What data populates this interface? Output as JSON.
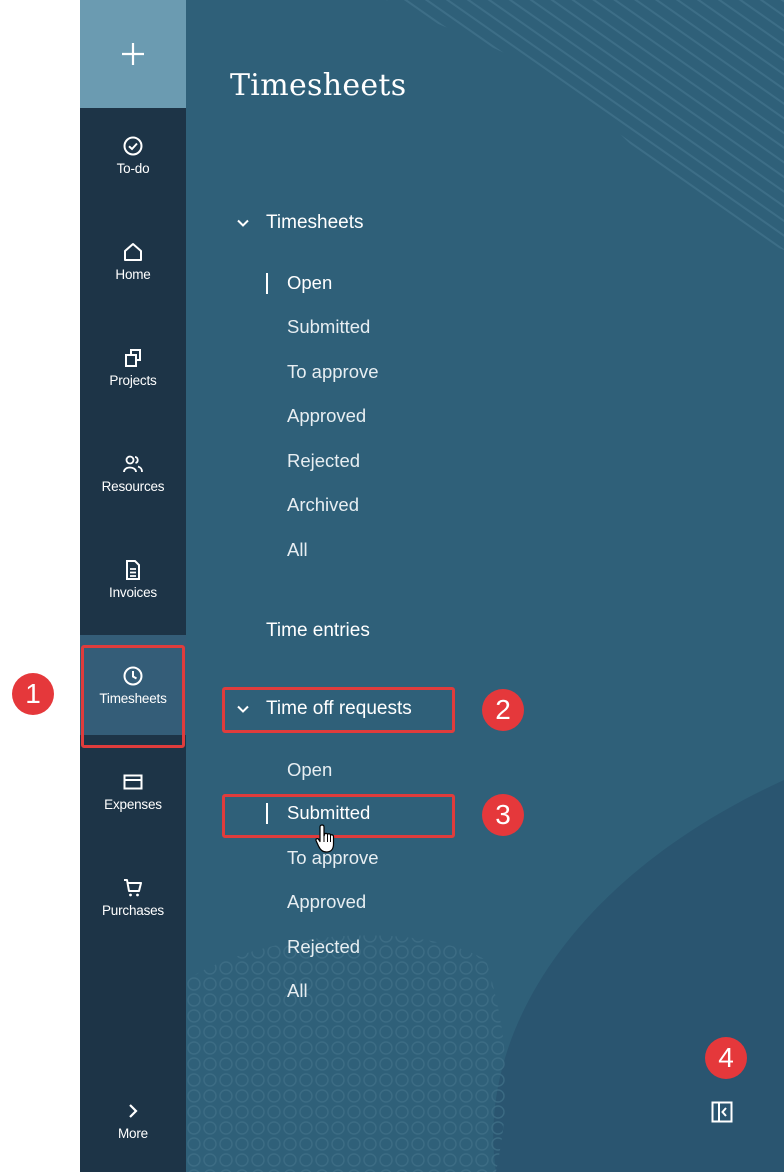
{
  "rail": {
    "plus_label": "+",
    "items": [
      {
        "label": "To-do",
        "icon": "check-circle-icon"
      },
      {
        "label": "Home",
        "icon": "home-icon"
      },
      {
        "label": "Projects",
        "icon": "projects-icon"
      },
      {
        "label": "Resources",
        "icon": "people-icon"
      },
      {
        "label": "Invoices",
        "icon": "document-icon"
      },
      {
        "label": "Timesheets",
        "icon": "clock-icon",
        "active": true
      },
      {
        "label": "Expenses",
        "icon": "card-icon"
      },
      {
        "label": "Purchases",
        "icon": "cart-icon"
      }
    ],
    "more_label": "More"
  },
  "panel": {
    "title": "Timesheets",
    "timesheets_section": {
      "label": "Timesheets",
      "items": [
        "Open",
        "Submitted",
        "To approve",
        "Approved",
        "Rejected",
        "Archived",
        "All"
      ],
      "selected": "Open"
    },
    "time_entries_label": "Time entries",
    "time_off_section": {
      "label": "Time off requests",
      "items": [
        "Open",
        "Submitted",
        "To approve",
        "Approved",
        "Rejected",
        "All"
      ],
      "selected": "Submitted"
    },
    "collapse_icon": "collapse-panel-icon"
  },
  "annotations": {
    "badges": [
      "1",
      "2",
      "3",
      "4"
    ],
    "highlight_color": "#e03c3c",
    "badge_color": "#e5383b"
  },
  "colors": {
    "rail_bg": "#1d3447",
    "rail_active": "#345d78",
    "plus_bg": "#6b9bb1",
    "panel_bg": "#2f6079"
  }
}
